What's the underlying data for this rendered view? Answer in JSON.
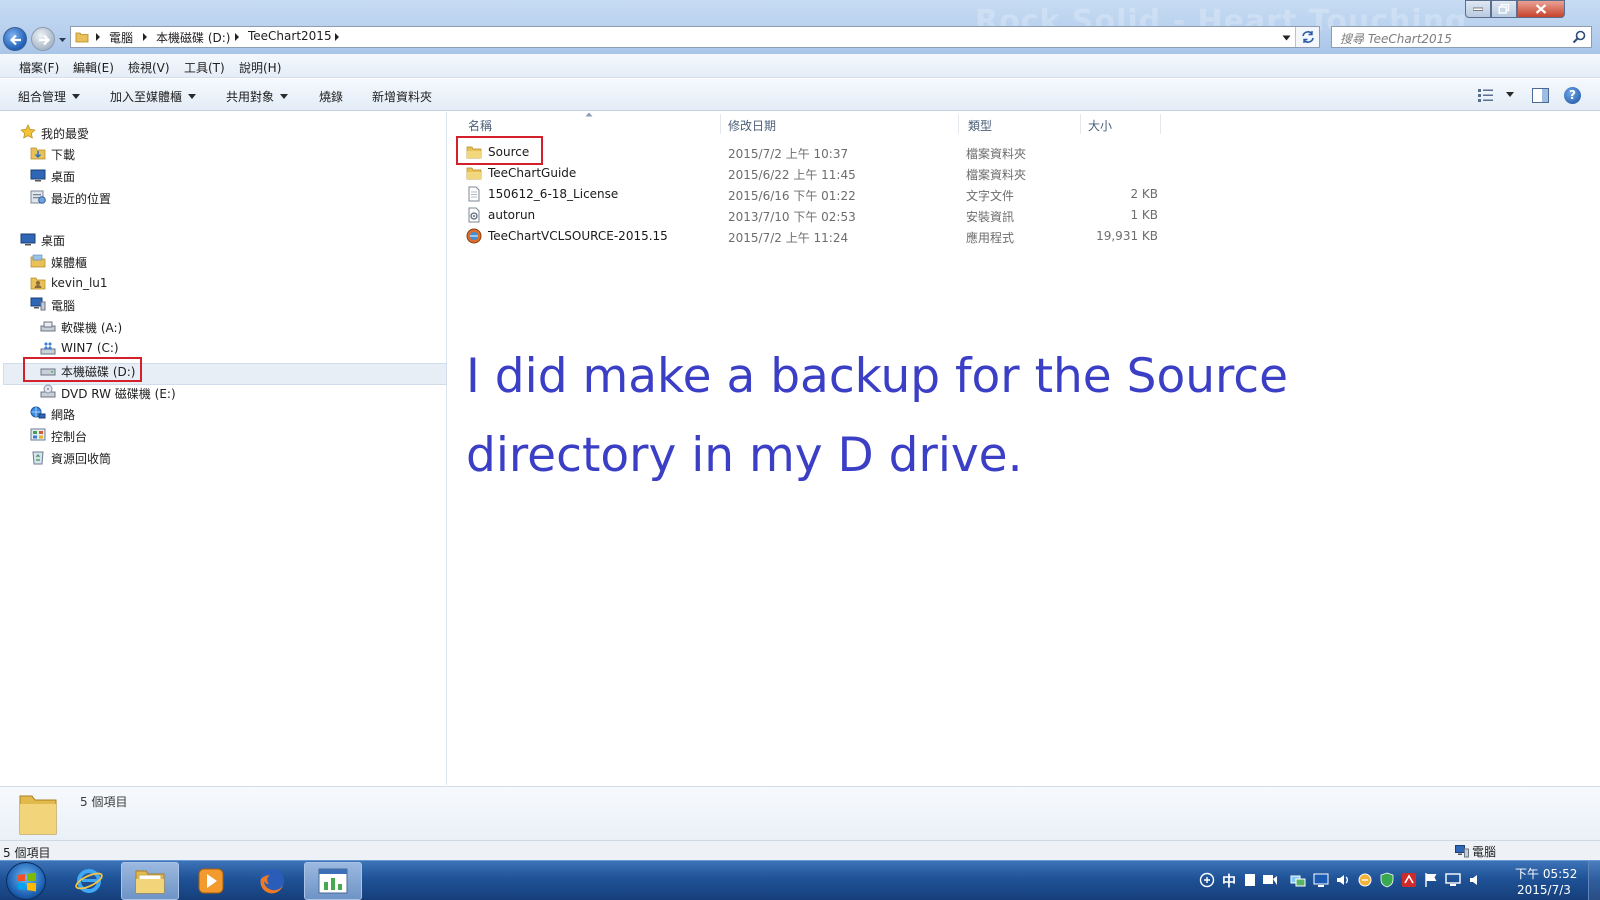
{
  "window": {
    "watermark": "Rock Solid - Heart Touching",
    "breadcrumbs": [
      "電腦",
      "本機磁碟 (D:)",
      "TeeChart2015"
    ],
    "search_placeholder": "搜尋 TeeChart2015"
  },
  "menubar": [
    "檔案(F)",
    "編輯(E)",
    "檢視(V)",
    "工具(T)",
    "說明(H)"
  ],
  "toolbar": {
    "organize": "組合管理",
    "include_library": "加入至媒體櫃",
    "share_with": "共用對象",
    "burn": "燒錄",
    "new_folder": "新增資料夾"
  },
  "nav": {
    "favorites": "我的最愛",
    "downloads": "下載",
    "desktop_fav": "桌面",
    "recent": "最近的位置",
    "desktop": "桌面",
    "libraries": "媒體櫃",
    "user": "kevin_lu1",
    "computer": "電腦",
    "floppy": "軟碟機 (A:)",
    "drive_c": "WIN7 (C:)",
    "drive_d": "本機磁碟 (D:)",
    "drive_e": "DVD RW 磁碟機 (E:)",
    "network": "網路",
    "control_panel": "控制台",
    "recycle_bin": "資源回收筒"
  },
  "columns": {
    "name": "名稱",
    "date": "修改日期",
    "type": "類型",
    "size": "大小"
  },
  "files": [
    {
      "name": "Source",
      "date": "2015/7/2 上午 10:37",
      "type": "檔案資料夾",
      "size": "",
      "icon": "folder-icon"
    },
    {
      "name": "TeeChartGuide",
      "date": "2015/6/22 上午 11:45",
      "type": "檔案資料夾",
      "size": "",
      "icon": "folder-icon"
    },
    {
      "name": "150612_6-18_License",
      "date": "2015/6/16 下午 01:22",
      "type": "文字文件",
      "size": "2 KB",
      "icon": "text-file-icon"
    },
    {
      "name": "autorun",
      "date": "2013/7/10 下午 02:53",
      "type": "安裝資訊",
      "size": "1 KB",
      "icon": "setup-info-icon"
    },
    {
      "name": "TeeChartVCLSOURCE-2015.15",
      "date": "2015/7/2 上午 11:24",
      "type": "應用程式",
      "size": "19,931 KB",
      "icon": "application-icon"
    }
  ],
  "annotation": {
    "line1": "I did make a backup for the Source",
    "line2": "directory in my D drive."
  },
  "details": {
    "count": "5 個項目"
  },
  "status": {
    "left": "5 個項目",
    "right": "電腦"
  },
  "taskbar": {
    "ime": "中",
    "time": "下午 05:52",
    "date": "2015/7/3"
  },
  "colors": {
    "annotation": "#3b3fc5",
    "highlight_box": "#d4202b",
    "taskbar": "#1f5297"
  }
}
